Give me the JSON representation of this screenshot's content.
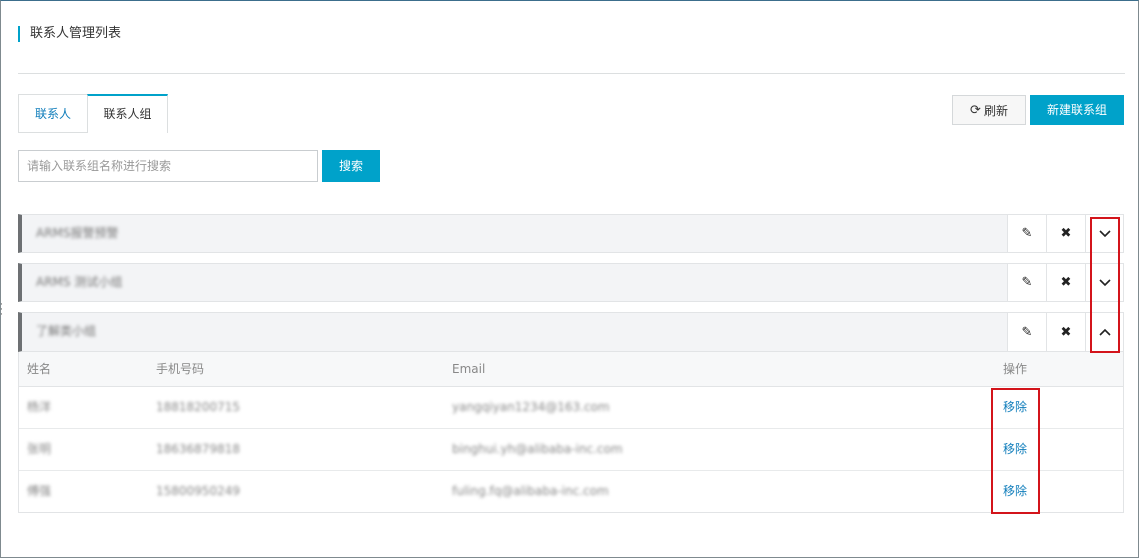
{
  "page": {
    "title": "联系人管理列表"
  },
  "tabs": [
    {
      "label": "联系人",
      "active": false
    },
    {
      "label": "联系人组",
      "active": true
    }
  ],
  "toolbar": {
    "refresh_label": "刷新",
    "refresh_icon": "refresh-icon",
    "new_group_label": "新建联系组"
  },
  "search": {
    "placeholder": "请输入联系组名称进行搜索",
    "value": "",
    "button_label": "搜索"
  },
  "groups": [
    {
      "name": "ARMS报警预警",
      "expanded": false
    },
    {
      "name": "ARMS 测试小组",
      "expanded": false
    },
    {
      "name": "了解类小组",
      "expanded": true
    }
  ],
  "icons": {
    "edit": "✎",
    "delete": "✖",
    "expand": "⌄",
    "collapse": "⌃"
  },
  "members_table": {
    "headers": [
      "姓名",
      "手机号码",
      "Email",
      "操作"
    ],
    "rows": [
      {
        "name": "杨洋",
        "phone": "18818200715",
        "email": "yangqiyan1234@163.com",
        "action": "移除"
      },
      {
        "name": "张明",
        "phone": "18636879818",
        "email": "binghui.yh@alibaba-inc.com",
        "action": "移除"
      },
      {
        "name": "傅强",
        "phone": "15800950249",
        "email": "fuling.fq@alibaba-inc.com",
        "action": "移除"
      }
    ]
  },
  "colors": {
    "accent": "#00a2ca",
    "link": "#0f7dbb",
    "highlight": "#d3141b",
    "group_bar": "#6d7073"
  }
}
